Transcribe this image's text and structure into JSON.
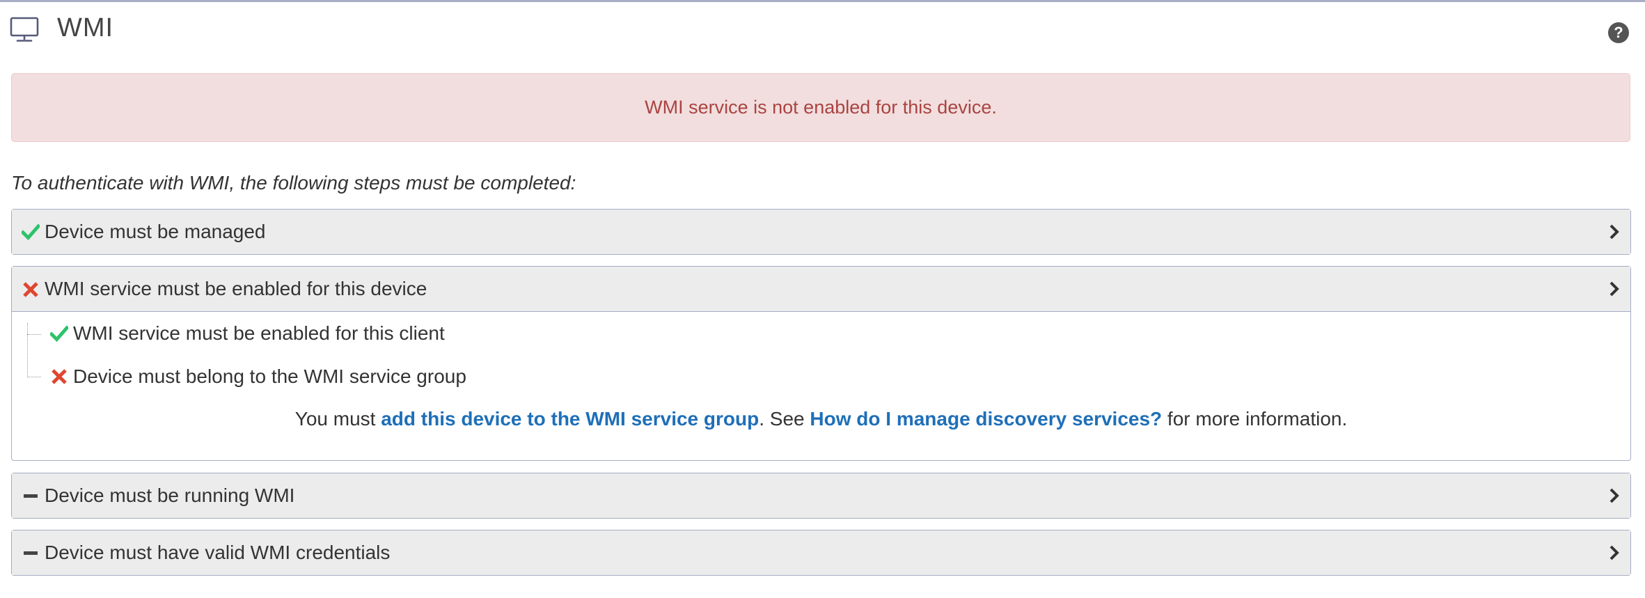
{
  "header": {
    "title": "WMI",
    "icon": "monitor-icon",
    "help_label": "?",
    "help_icon": "help-icon"
  },
  "alert": {
    "message": "WMI service is not enabled for this device.",
    "bg_color": "#f2dede",
    "text_color": "#a94442"
  },
  "intro": "To authenticate with WMI, the following steps must be completed:",
  "colors": {
    "success": "#2ec26a",
    "error": "#e0452f",
    "pending": "#444444",
    "link": "#1e6fb8"
  },
  "steps": [
    {
      "label": "Device must be managed",
      "status": "complete",
      "icon": "check-icon",
      "expanded": false
    },
    {
      "label": "WMI service must be enabled for this device",
      "status": "failed",
      "icon": "x-icon",
      "expanded": true,
      "substeps": [
        {
          "label": "WMI service must be enabled for this client",
          "status": "complete",
          "icon": "check-icon"
        },
        {
          "label": "Device must belong to the WMI service group",
          "status": "failed",
          "icon": "x-icon"
        }
      ],
      "instruction": {
        "prefix": "You must ",
        "action_link": "add this device to the WMI service group",
        "middle": ". See ",
        "help_link": "How do I manage discovery services?",
        "suffix": " for more information."
      }
    },
    {
      "label": "Device must be running WMI",
      "status": "pending",
      "icon": "dash-icon",
      "expanded": false
    },
    {
      "label": "Device must have valid WMI credentials",
      "status": "pending",
      "icon": "dash-icon",
      "expanded": false
    }
  ]
}
